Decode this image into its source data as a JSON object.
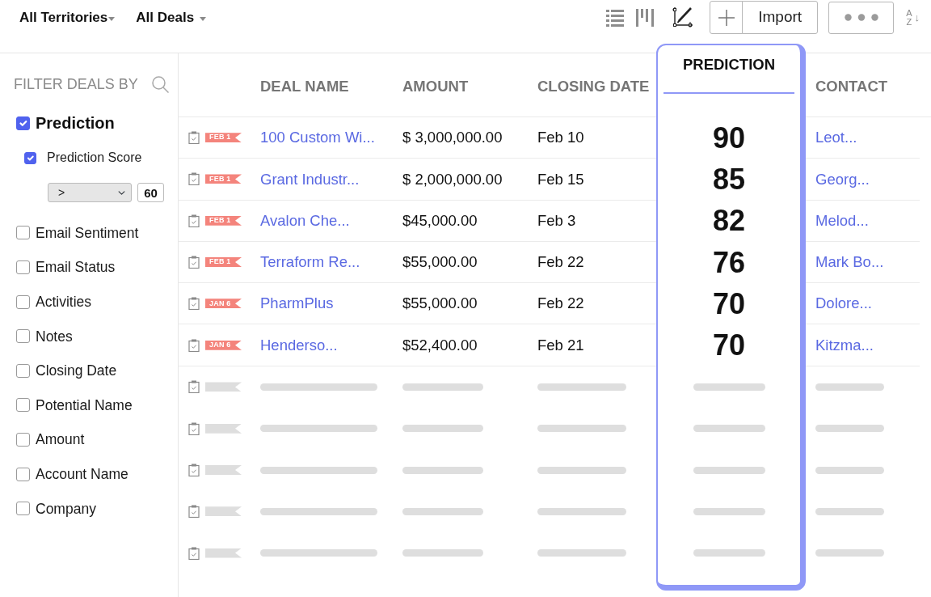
{
  "toolbar": {
    "territory_menu": "All Territories",
    "view_menu": "All Deals",
    "import_button": "Import",
    "sort_button": {
      "upper": "A",
      "lower": "Z",
      "arrow": "↓"
    }
  },
  "sidebar": {
    "title": "FILTER DEALS BY",
    "filters": [
      {
        "kind": "group",
        "label": "Prediction",
        "checked": true,
        "children": [
          {
            "label": "Prediction Score",
            "checked": true,
            "operator": ">",
            "value": "60"
          }
        ]
      },
      {
        "kind": "field",
        "label": "Email Sentiment",
        "checked": false
      },
      {
        "kind": "field",
        "label": "Email Status",
        "checked": false
      },
      {
        "kind": "field",
        "label": "Activities",
        "checked": false
      },
      {
        "kind": "field",
        "label": "Notes",
        "checked": false
      },
      {
        "kind": "field",
        "label": "Closing Date",
        "checked": false
      },
      {
        "kind": "field",
        "label": "Potential Name",
        "checked": false
      },
      {
        "kind": "field",
        "label": "Amount",
        "checked": false
      },
      {
        "kind": "field",
        "label": "Account Name",
        "checked": false
      },
      {
        "kind": "field",
        "label": "Company",
        "checked": false
      }
    ]
  },
  "table": {
    "columns": [
      {
        "label": "DEAL NAME",
        "kind": "link",
        "highlighted": false
      },
      {
        "label": "AMOUNT",
        "kind": "text",
        "highlighted": false
      },
      {
        "label": "CLOSING DATE",
        "kind": "text",
        "highlighted": false
      },
      {
        "label": "PREDICTION",
        "kind": "score",
        "highlighted": true
      },
      {
        "label": "CONTACT",
        "kind": "link",
        "highlighted": false
      }
    ],
    "rows": [
      {
        "kind": "deal",
        "tag": "FEB 1",
        "cells": [
          "100 Custom Wi...",
          "$ 3,000,000.00",
          "Feb 10",
          "90",
          "Leot..."
        ]
      },
      {
        "kind": "deal",
        "tag": "FEB 1",
        "cells": [
          "Grant Industr...",
          "$ 2,000,000.00",
          "Feb 15",
          "85",
          "Georg..."
        ]
      },
      {
        "kind": "deal",
        "tag": "FEB 1",
        "cells": [
          "Avalon Che...",
          "$45,000.00",
          "Feb 3",
          "82",
          "Melod..."
        ]
      },
      {
        "kind": "deal",
        "tag": "FEB 1",
        "cells": [
          "Terraform Re...",
          "$55,000.00",
          "Feb 22",
          "76",
          "Mark Bo..."
        ]
      },
      {
        "kind": "deal",
        "tag": "JAN 6",
        "cells": [
          "PharmPlus",
          "$55,000.00",
          "Feb 22",
          "70",
          "Dolore..."
        ]
      },
      {
        "kind": "deal",
        "tag": "JAN 6",
        "cells": [
          "Henderso...",
          "$52,400.00",
          "Feb 21",
          "70",
          "Kitzma..."
        ]
      },
      {
        "kind": "skeleton"
      },
      {
        "kind": "skeleton"
      },
      {
        "kind": "skeleton"
      },
      {
        "kind": "skeleton"
      },
      {
        "kind": "skeleton"
      }
    ]
  }
}
